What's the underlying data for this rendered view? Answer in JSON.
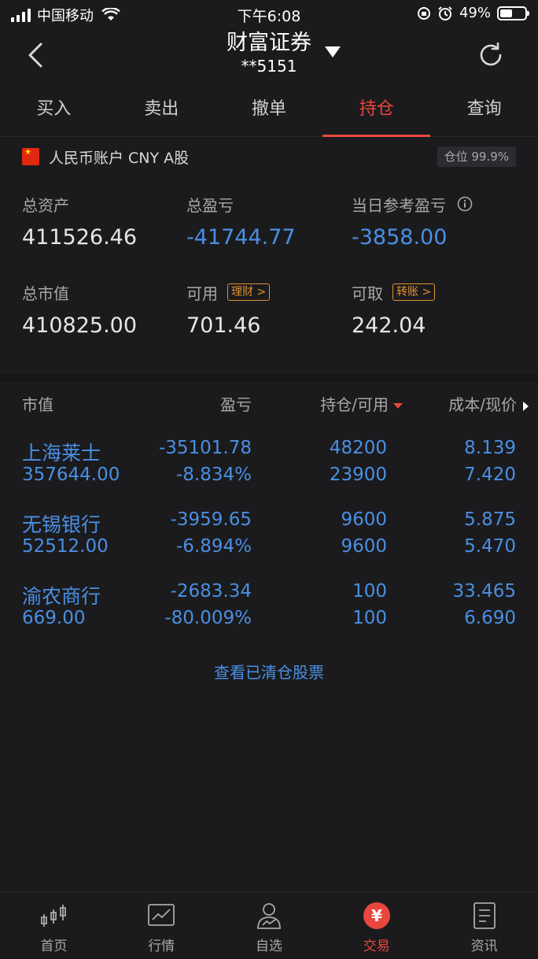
{
  "status_bar": {
    "carrier": "中国移动",
    "time": "下午6:08",
    "battery": "49%",
    "battery_level": 0.49
  },
  "nav": {
    "title": "财富证券",
    "account_masked": "**5151"
  },
  "tabs": [
    {
      "label": "买入",
      "active": false
    },
    {
      "label": "卖出",
      "active": false
    },
    {
      "label": "撤单",
      "active": false
    },
    {
      "label": "持仓",
      "active": true
    },
    {
      "label": "查询",
      "active": false
    }
  ],
  "account": {
    "label": "人民币账户 CNY A股",
    "position_ratio": "仓位 99.9%"
  },
  "summary": {
    "total_assets_label": "总资产",
    "total_assets": "411526.46",
    "total_pnl_label": "总盈亏",
    "total_pnl": "-41744.77",
    "daily_pnl_label": "当日参考盈亏",
    "daily_pnl": "-3858.00",
    "market_value_label": "总市值",
    "market_value": "410825.00",
    "available_label": "可用",
    "available": "701.46",
    "wealth_btn": "理财 >",
    "withdrawable_label": "可取",
    "withdrawable": "242.04",
    "transfer_btn": "转账 >"
  },
  "table": {
    "headers": [
      "市值",
      "盈亏",
      "持仓/可用",
      "成本/现价"
    ],
    "rows": [
      {
        "name": "上海莱士",
        "market_value": "357644.00",
        "pnl": "-35101.78",
        "pnl_pct": "-8.834%",
        "holding": "48200",
        "available": "23900",
        "cost": "8.139",
        "price": "7.420"
      },
      {
        "name": "无锡银行",
        "market_value": "52512.00",
        "pnl": "-3959.65",
        "pnl_pct": "-6.894%",
        "holding": "9600",
        "available": "9600",
        "cost": "5.875",
        "price": "5.470"
      },
      {
        "name": "渝农商行",
        "market_value": "669.00",
        "pnl": "-2683.34",
        "pnl_pct": "-80.009%",
        "holding": "100",
        "available": "100",
        "cost": "33.465",
        "price": "6.690"
      }
    ]
  },
  "cleared_link": "查看已清仓股票",
  "bottom_tabs": [
    {
      "label": "首页",
      "icon": "candlestick-icon",
      "active": false
    },
    {
      "label": "行情",
      "icon": "chart-icon",
      "active": false
    },
    {
      "label": "自选",
      "icon": "user-chart-icon",
      "active": false
    },
    {
      "label": "交易",
      "icon": "yuan-icon",
      "active": true
    },
    {
      "label": "资讯",
      "icon": "news-icon",
      "active": false
    }
  ],
  "colors": {
    "accent_red": "#e8473f",
    "negative_blue": "#4a8fe3",
    "tag_orange": "#e2902f",
    "background": "#1b1b1d"
  }
}
